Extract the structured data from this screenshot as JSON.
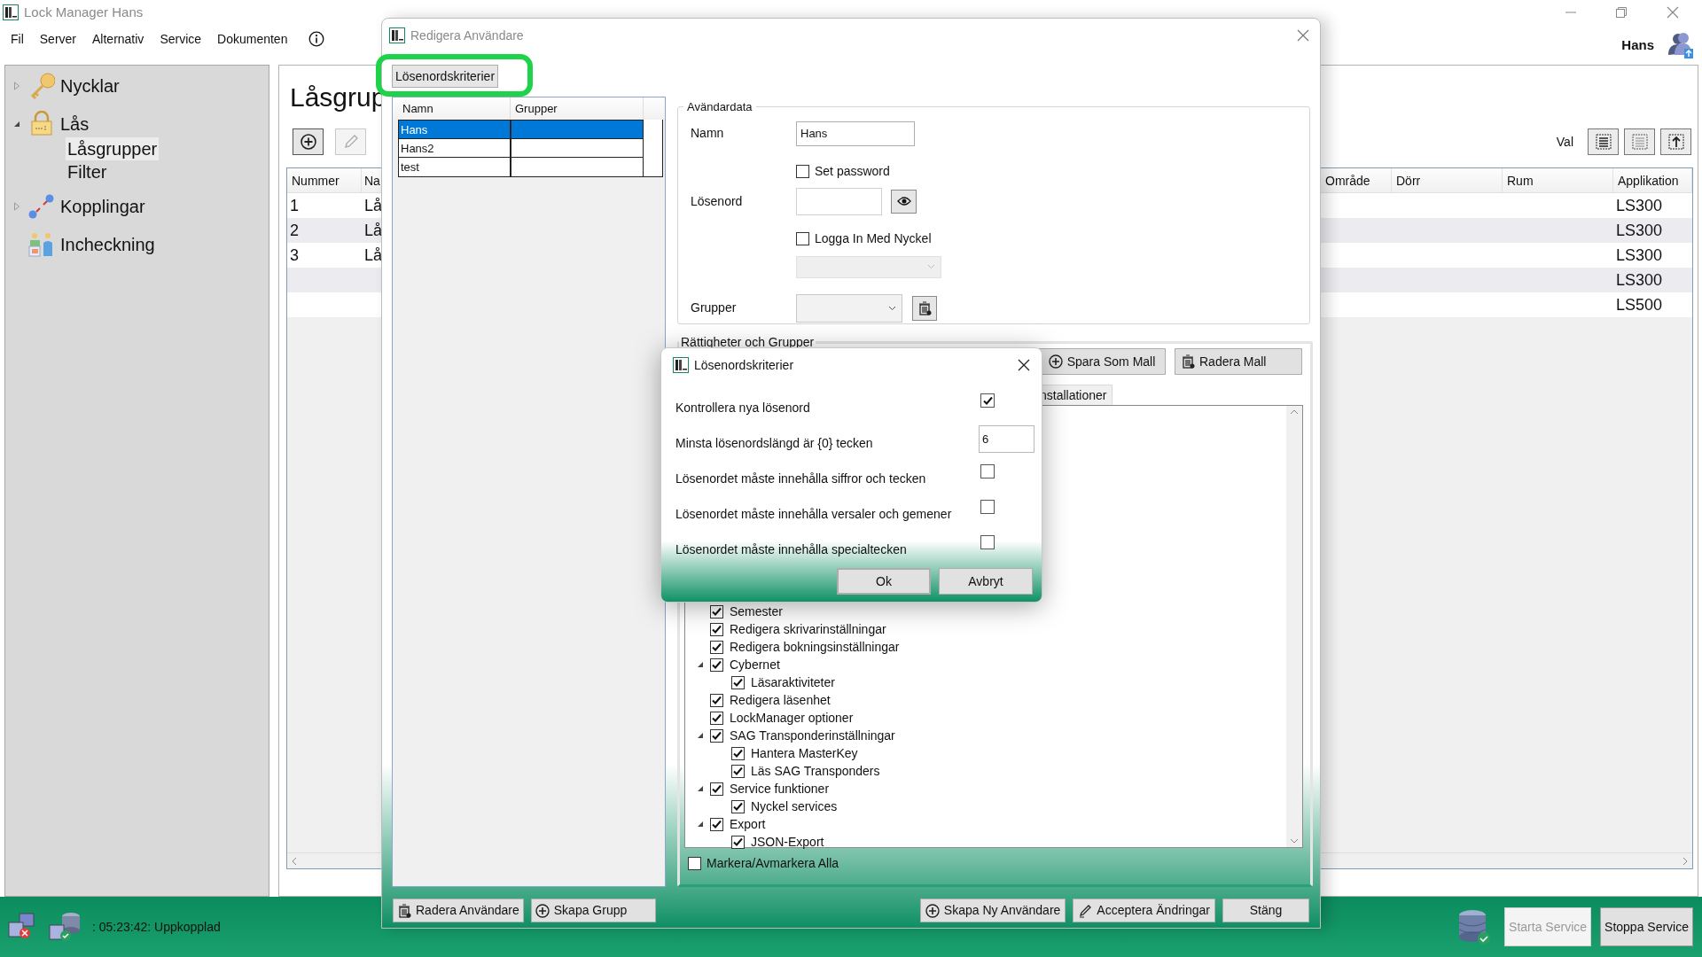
{
  "app": {
    "title": "Lock Manager Hans",
    "menu": [
      "Fil",
      "Server",
      "Alternativ",
      "Service",
      "Dokumenten"
    ],
    "user": "Hans"
  },
  "sidebar": {
    "items": [
      {
        "label": "Nycklar",
        "expanded": false
      },
      {
        "label": "Lås",
        "expanded": true,
        "children": [
          {
            "label": "Låsgrupper",
            "selected": true
          },
          {
            "label": "Filter",
            "selected": false
          }
        ]
      },
      {
        "label": "Kopplingar",
        "expanded": false
      },
      {
        "label": "Incheckning"
      }
    ]
  },
  "main": {
    "heading": "Låsgrup",
    "toolbar_buttons": [
      {
        "disabled": false
      },
      {
        "disabled": true
      }
    ],
    "view_label": "Val",
    "table": {
      "columns": [
        "Nummer",
        "Na",
        "Område",
        "Dörr",
        "Rum",
        "Applikation"
      ],
      "rows": [
        {
          "number": "1",
          "name": "Lå",
          "application": "LS300"
        },
        {
          "number": "2",
          "name": "Lå",
          "application": "LS300"
        },
        {
          "number": "3",
          "name": "Lå",
          "application": "LS300"
        },
        {
          "application": "LS300"
        },
        {
          "application": "LS500"
        }
      ]
    }
  },
  "edit_dialog": {
    "title": "Redigera Användare",
    "criteria_button": {
      "label": "Lösenordskriterier",
      "highlighted": true
    },
    "users": {
      "columns": [
        "Namn",
        "Grupper"
      ],
      "rows": [
        {
          "name": "Hans",
          "selected": true
        },
        {
          "name": "Hans2",
          "selected": false
        },
        {
          "name": "test",
          "selected": false
        }
      ]
    },
    "user_data": {
      "title": "Avändardata",
      "name_label": "Namn",
      "name_value": "Hans",
      "set_password": {
        "label": "Set password",
        "checked": false
      },
      "password_label": "Lösenord",
      "key_login": {
        "label": "Logga In Med Nyckel",
        "checked": false
      },
      "groups_label": "Grupper"
    },
    "rights": {
      "title": "Rättigheter och Grupper",
      "buttons": [
        "Spara Som Mall",
        "Radera Mall"
      ],
      "tab": "nstallationer",
      "tree": [
        {
          "label": "Semester",
          "checked": true
        },
        {
          "label": "Redigera skrivarinställningar",
          "checked": true
        },
        {
          "label": "Redigera bokningsinställningar",
          "checked": true
        },
        {
          "label": "Cybernet",
          "checked": true,
          "expanded": true,
          "children": [
            {
              "label": "Läsaraktiviteter",
              "checked": true
            }
          ]
        },
        {
          "label": "Redigera läsenhet",
          "checked": true
        },
        {
          "label": "LockManager optioner",
          "checked": true
        },
        {
          "label": "SAG Transponderinställningar",
          "checked": true,
          "expanded": true,
          "children": [
            {
              "label": "Hantera MasterKey",
              "checked": true
            },
            {
              "label": "Läs SAG Transponders",
              "checked": true
            }
          ]
        },
        {
          "label": "Service funktioner",
          "checked": true,
          "expanded": true,
          "children": [
            {
              "label": "Nyckel services",
              "checked": true
            }
          ]
        },
        {
          "label": "Export",
          "checked": true,
          "expanded": true,
          "children": [
            {
              "label": "JSON-Export",
              "checked": true
            }
          ]
        }
      ],
      "select_all": {
        "label": "Markera/Avmarkera Alla",
        "checked": false
      }
    },
    "footer_left": [
      "Radera Användare",
      "Skapa Grupp"
    ],
    "footer_right": [
      "Skapa Ny Användare",
      "Acceptera Ändringar",
      "Stäng"
    ]
  },
  "criteria_dialog": {
    "title": "Lösenordskriterier",
    "rows": [
      {
        "kind": "checkbox",
        "label": "Kontrollera nya lösenord",
        "checked": true
      },
      {
        "kind": "number",
        "label": "Minsta lösenordslängd är {0} tecken",
        "value": "6"
      },
      {
        "kind": "checkbox",
        "label": "Lösenordet måste innehålla siffror och tecken",
        "checked": false
      },
      {
        "kind": "checkbox",
        "label": "Lösenordet måste innehålla versaler och gemener",
        "checked": false
      },
      {
        "kind": "checkbox",
        "label": "Lösenordet måste innehålla specialtecken",
        "checked": false
      }
    ],
    "buttons": [
      {
        "label": "Ok",
        "default": true
      },
      {
        "label": "Avbryt",
        "default": false
      }
    ]
  },
  "status_bar": {
    "text": ": 05:23:42: Uppkopplad",
    "buttons": [
      {
        "label": "Starta Service",
        "disabled": true
      },
      {
        "label": "Stoppa Service",
        "disabled": false
      }
    ]
  }
}
